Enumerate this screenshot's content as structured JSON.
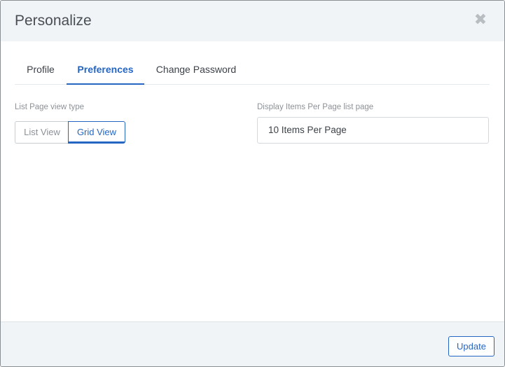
{
  "dialog": {
    "title": "Personalize",
    "close_icon": "close-icon"
  },
  "tabs": [
    {
      "label": "Profile",
      "active": false
    },
    {
      "label": "Preferences",
      "active": true
    },
    {
      "label": "Change Password",
      "active": false
    }
  ],
  "preferences": {
    "view_type_label": "List Page view type",
    "view_options": [
      "List View",
      "Grid View"
    ],
    "selected_view": "Grid View",
    "items_per_page_label": "Display Items Per Page list page",
    "items_per_page_value": "10 Items Per Page"
  },
  "footer": {
    "update_label": "Update"
  },
  "colors": {
    "accent": "#2566c3",
    "header_bg": "#f0f4f7",
    "muted_text": "#8c9197"
  }
}
